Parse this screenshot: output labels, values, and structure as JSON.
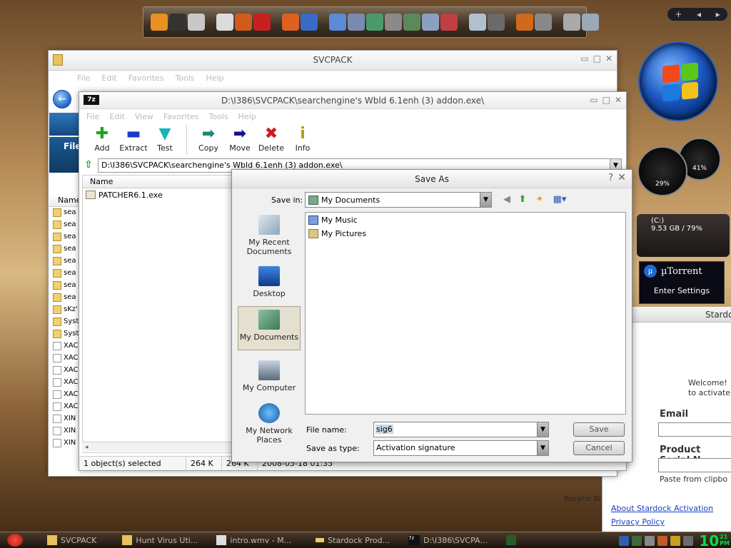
{
  "desktop": {
    "dock_items": [
      "media-player",
      "321-player",
      "flash",
      "disc",
      "paint",
      "books",
      "firefox",
      "bluetooth",
      "notes",
      "calculator",
      "folder",
      "tools",
      "map",
      "files",
      "pencil",
      "gallery",
      "settings",
      "winamp",
      "power",
      "back",
      "trash"
    ],
    "controls": [
      "+",
      "◂",
      "▸"
    ],
    "drive": {
      "label": "(C:)",
      "usage": "9.53 GB / 79%"
    },
    "gauge_cpu": "29%",
    "gauge_mem": "41%",
    "utorrent": {
      "title": "µTorrent",
      "action": "Enter Settings"
    },
    "recycle_label": "Recycle Bi"
  },
  "stardock": {
    "header": "Stardoc",
    "welcome_1": "Welcome!",
    "welcome_2": "to activate",
    "email_label": "Email",
    "serial_label": "Product Serial N",
    "paste_label": "Paste from clipbo",
    "link_about": "About Stardock Activation",
    "link_privacy": "Privacy Policy"
  },
  "svcpack": {
    "title": "SVCPACK",
    "menu": [
      "File",
      "Edit",
      "Favorites",
      "Tools",
      "Help"
    ],
    "nav_label": "File",
    "col_name": "Name",
    "rows": [
      "sea",
      "sea",
      "sea",
      "sea",
      "sea",
      "sea",
      "sea",
      "sea",
      "sKz'",
      "Syst",
      "Syst",
      "XAC",
      "XAC",
      "XAC",
      "XAC",
      "XAC",
      "XAC",
      "XIN",
      "XIN",
      "XIN"
    ]
  },
  "sevenzip": {
    "title": "D:\\I386\\SVCPACK\\searchengine's Wbld 6.1enh (3) addon.exe\\",
    "menu": [
      "File",
      "Edit",
      "View",
      "Favorites",
      "Tools",
      "Help"
    ],
    "toolbar": [
      {
        "label": "Add",
        "symbol": "✚",
        "color": "#1aa51a"
      },
      {
        "label": "Extract",
        "symbol": "▬",
        "color": "#1a3ac8"
      },
      {
        "label": "Test",
        "symbol": "▼",
        "color": "#18b4b4"
      },
      {
        "label": "Copy",
        "symbol": "➡",
        "color": "#1a8a7a"
      },
      {
        "label": "Move",
        "symbol": "➡",
        "color": "#14148a"
      },
      {
        "label": "Delete",
        "symbol": "✖",
        "color": "#d01818"
      },
      {
        "label": "Info",
        "symbol": "i",
        "color": "#b89a10"
      }
    ],
    "address": "D:\\I386\\SVCPACK\\searchengine's Wbld 6.1enh (3) addon.exe\\",
    "col_name": "Name",
    "files": [
      "PATCHER6.1.exe"
    ],
    "status": [
      "1 object(s) selected",
      "264 K",
      "264 K",
      "2008-05-18 01:35"
    ]
  },
  "saveas": {
    "title": "Save As",
    "help": "?",
    "close": "✕",
    "save_in_label": "Save in:",
    "save_in_value": "My Documents",
    "places": [
      "My Recent Documents",
      "Desktop",
      "My Documents",
      "My Computer",
      "My Network Places"
    ],
    "files": [
      "My Music",
      "My Pictures"
    ],
    "file_name_label": "File name:",
    "file_name_value": "sig6",
    "save_type_label": "Save as type:",
    "save_type_value": "Activation signature",
    "save_button": "Save",
    "cancel_button": "Cancel"
  },
  "taskbar": {
    "items": [
      "SVCPACK",
      "Hunt Virus Uti...",
      "intro.wmv - M...",
      "Stardock Prod...",
      "D:\\I386\\SVCPA..."
    ],
    "clock_hour": "10",
    "clock_min": "21",
    "clock_ampm": "PM"
  }
}
